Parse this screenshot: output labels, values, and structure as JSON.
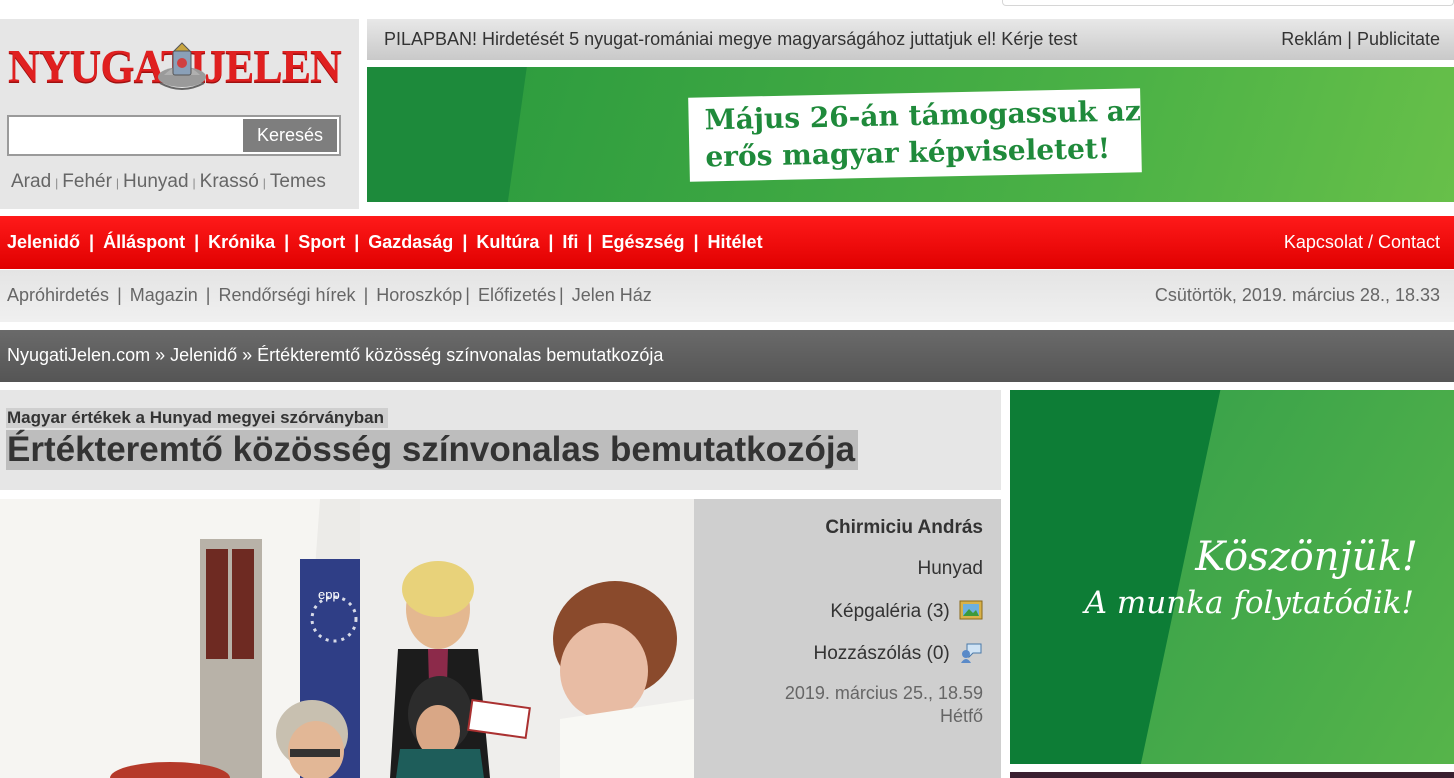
{
  "logo": {
    "left": "NYUGATI",
    "right": "JELEN"
  },
  "search": {
    "placeholder": "",
    "button_label": "Keresés"
  },
  "regions": [
    "Arad",
    "Fehér",
    "Hunyad",
    "Krassó",
    "Temes"
  ],
  "promo": {
    "text": "PILAPBAN! Hirdetését 5 nyugat-romániai megye magyarságához juttatjuk el! Kérje test",
    "links": "Reklám | Publicitate"
  },
  "banner_top": {
    "line1": "Május 26-án támogassuk az",
    "line2": "erős magyar képviseletet!"
  },
  "main_nav": {
    "items": [
      "Jelenidő",
      "Álláspont",
      "Krónika",
      "Sport",
      "Gazdaság",
      "Kultúra",
      "Ifi",
      "Egészség",
      "Hitélet"
    ],
    "contact": "Kapcsolat / Contact"
  },
  "sub_nav": {
    "items": [
      "Apróhirdetés",
      "Magazin",
      "Rendőrségi hírek",
      "Horoszkóp",
      "Előfizetés",
      "Jelen Ház"
    ],
    "date": "Csütörtök, 2019. március 28., 18.33"
  },
  "breadcrumb": "NyugatiJelen.com » Jelenidő » Értékteremtő közösség színvonalas bemutatkozója",
  "article": {
    "kicker": "Magyar értékek a Hunyad megyei szórványban",
    "title": "Értékteremtő közösség színvonalas bemutatkozója",
    "author": "Chirmiciu András",
    "region": "Hunyad",
    "gallery": "Képgaléria (3)",
    "comments": "Hozzászólás (0)",
    "date": "2019. március 25., 18.59",
    "weekday": "Hétfő"
  },
  "banner_side": {
    "line1": "Köszönjük!",
    "line2": "A munka folytatódik!"
  },
  "colors": {
    "nav_red": "#ee0000",
    "banner_green": "#1d8a3b",
    "logo_red": "#e02020"
  },
  "icons": [
    "emblem-icon",
    "gallery-icon",
    "comment-icon"
  ]
}
